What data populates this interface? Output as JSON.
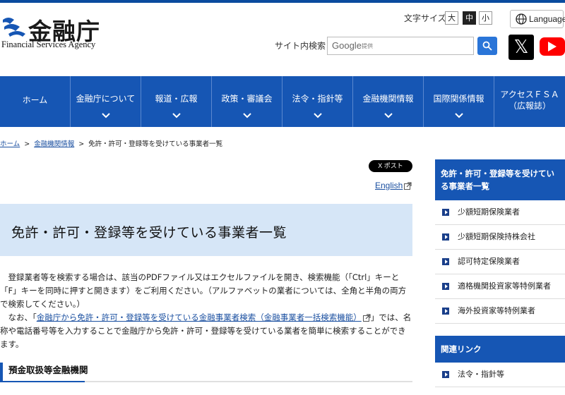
{
  "header": {
    "logo_title": "金融庁",
    "logo_en": "Financial Services Agency",
    "fontsize_label": "文字サイズ",
    "fontsize_options": [
      "大",
      "中",
      "小"
    ],
    "fontsize_selected": "中",
    "language_label": "Language",
    "site_search_label": "サイト内検索",
    "search_google": "Google",
    "search_teikyo": "提供",
    "x_label": "𝕏",
    "colors": {
      "accent": "#1656b4",
      "search_button": "#2a75d8",
      "youtube": "#ff0000"
    }
  },
  "nav": {
    "items": [
      {
        "label": "ホーム",
        "has_sub": false
      },
      {
        "label": "金融庁について",
        "has_sub": true
      },
      {
        "label": "報道・広報",
        "has_sub": true
      },
      {
        "label": "政策・審議会",
        "has_sub": true
      },
      {
        "label": "法令・指針等",
        "has_sub": true
      },
      {
        "label": "金融機関情報",
        "has_sub": true
      },
      {
        "label": "国際関係情報",
        "has_sub": true
      },
      {
        "label": "アクセスＦＳＡ",
        "label2": "（広報誌）",
        "has_sub": false
      }
    ]
  },
  "breadcrumb": {
    "home": "ホーム",
    "sep": ">",
    "parent": "金融機関情報",
    "current": "免許・許可・登録等を受けている事業者一覧"
  },
  "main": {
    "post_button": "X ポスト",
    "english_link": "English",
    "page_title": "免許・許可・登録等を受けている事業者一覧",
    "para1": "　登録業者等を検索する場合は、該当のPDFファイル又はエクセルファイルを開き、検索機能（「Ctrl」キーと「F」キーを同時に押すと開きます）をご利用ください。（アルファベットの業者については、全角と半角の両方で検索してください。）",
    "para2_prefix": "　なお、「",
    "para2_link": "金融庁から免許・許可・登録等を受けている金融事業者検索（金融事業者一括検索機能）",
    "para2_suffix": "」では、名称や電話番号等を入力することで金融庁から免許・許可・登録等を受けている業者を簡単に検索することができます。",
    "section_heading": "預金取扱等金融機関"
  },
  "sidebar": {
    "heading": "免許・許可・登録等を受けている事業者一覧",
    "items": [
      "少額短期保険業者",
      "少額短期保険持株会社",
      "認可特定保険業者",
      "適格機関投資家等特例業者",
      "海外投資家等特例業者"
    ],
    "related_heading": "関連リンク",
    "related_items": [
      "法令・指針等"
    ]
  }
}
